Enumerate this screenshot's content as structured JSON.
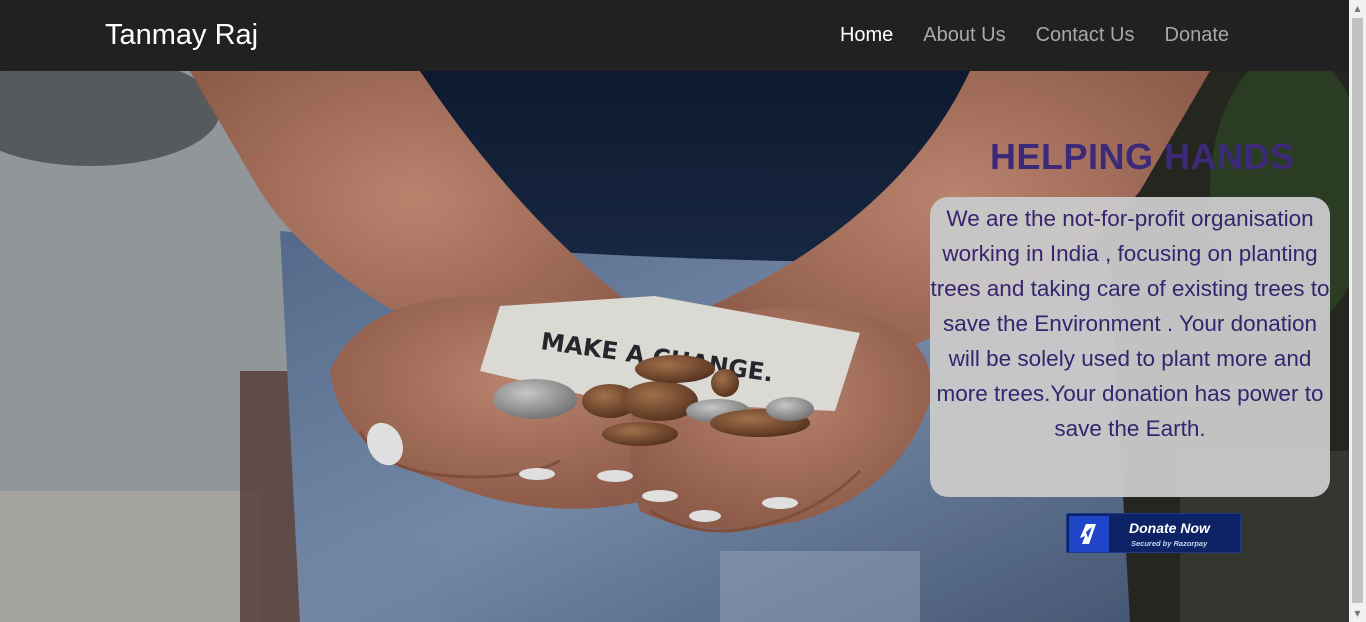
{
  "navbar": {
    "brand": "Tanmay Raj",
    "links": [
      {
        "label": "Home",
        "active": true
      },
      {
        "label": "About Us",
        "active": false
      },
      {
        "label": "Contact Us",
        "active": false
      },
      {
        "label": "Donate",
        "active": false
      }
    ]
  },
  "hero": {
    "title": "HELPING HANDS",
    "description": "We are the not-for-profit organisation working in India , focusing on planting trees and taking care of existing trees to save the Environment . Your donation will be solely used to plant more and more trees.Your donation has power to save the Earth.",
    "photo_note_text": "MAKE A CHANGE."
  },
  "donate_button": {
    "label": "Donate Now",
    "sublabel": "Secured by Razorpay",
    "icon": "razorpay-logo-icon"
  },
  "colors": {
    "navbar_bg": "#212121",
    "title_color": "#3c2a79",
    "card_bg": "#c9c9c9",
    "button_bg": "#0d2366"
  }
}
